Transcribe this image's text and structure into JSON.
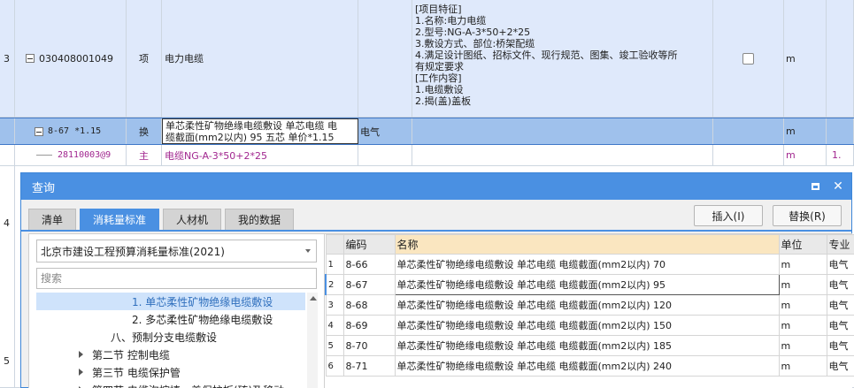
{
  "table": {
    "rows": [
      {
        "index": "3",
        "code": "030408001049",
        "type": "项",
        "name": "电力电缆",
        "spec_lines": [
          "[项目特征]",
          "1.名称:电力电缆",
          "2.型号:NG-A-3*50+2*25",
          "3.敷设方式、部位:桥架配缆",
          "4.满足设计图纸、招标文件、现行规范、图集、竣工验收等所",
          "有规定要求",
          "[工作内容]",
          "1.电缆敷设",
          "2.揭(盖)盖板"
        ],
        "unit": "m"
      },
      {
        "code": "8-67 *1.15",
        "type": "换",
        "name_lines": [
          "单芯柔性矿物绝缘电缆敷设 单芯电缆 电",
          "缆截面(mm2以内) 95  五芯 单价*1.15"
        ],
        "category": "电气",
        "unit": "m"
      },
      {
        "code": "28110003@9",
        "type": "主",
        "name": "电缆NG-A-3*50+2*25",
        "unit": "m",
        "extra": "1."
      },
      {
        "index": "4"
      },
      {
        "index": "5"
      }
    ]
  },
  "dialog": {
    "title": "查询",
    "tabs": [
      "清单",
      "消耗量标准",
      "人材机",
      "我的数据"
    ],
    "active_tab": 1,
    "insert_button": "插入(I)",
    "replace_button": "替换(R)",
    "standard_select": "北京市建设工程预算消耗量标准(2021)",
    "search_placeholder": "搜索",
    "tree": [
      {
        "label": "1. 单芯柔性矿物绝缘电缆敷设",
        "indent": 108,
        "selected": true
      },
      {
        "label": "2. 多芯柔性矿物绝缘电缆敷设",
        "indent": 108
      },
      {
        "label": "八、预制分支电缆敷设",
        "indent": 84
      },
      {
        "label": "第二节 控制电缆",
        "indent": 48,
        "arrow": true
      },
      {
        "label": "第三节 电缆保护管",
        "indent": 48,
        "arrow": true
      },
      {
        "label": "第四节 电缆沟挖填、盖保护板(砖)及移动",
        "indent": 48,
        "arrow": true
      }
    ],
    "grid": {
      "headers": [
        "",
        "编码",
        "名称",
        "单位",
        "专业"
      ],
      "rows": [
        {
          "num": "1",
          "code": "8-66",
          "name": "单芯柔性矿物绝缘电缆敷设 单芯电缆 电缆截面(mm2以内) 70",
          "unit": "m",
          "major": "电气"
        },
        {
          "num": "2",
          "code": "8-67",
          "name": "单芯柔性矿物绝缘电缆敷设 单芯电缆 电缆截面(mm2以内) 95",
          "unit": "m",
          "major": "电气"
        },
        {
          "num": "3",
          "code": "8-68",
          "name": "单芯柔性矿物绝缘电缆敷设 单芯电缆 电缆截面(mm2以内) 120",
          "unit": "m",
          "major": "电气"
        },
        {
          "num": "4",
          "code": "8-69",
          "name": "单芯柔性矿物绝缘电缆敷设 单芯电缆 电缆截面(mm2以内) 150",
          "unit": "m",
          "major": "电气"
        },
        {
          "num": "5",
          "code": "8-70",
          "name": "单芯柔性矿物绝缘电缆敷设 单芯电缆 电缆截面(mm2以内) 185",
          "unit": "m",
          "major": "电气"
        },
        {
          "num": "6",
          "code": "8-71",
          "name": "单芯柔性矿物绝缘电缆敷设 单芯电缆 电缆截面(mm2以内) 240",
          "unit": "m",
          "major": "电气"
        }
      ],
      "selected_row": 1
    }
  }
}
